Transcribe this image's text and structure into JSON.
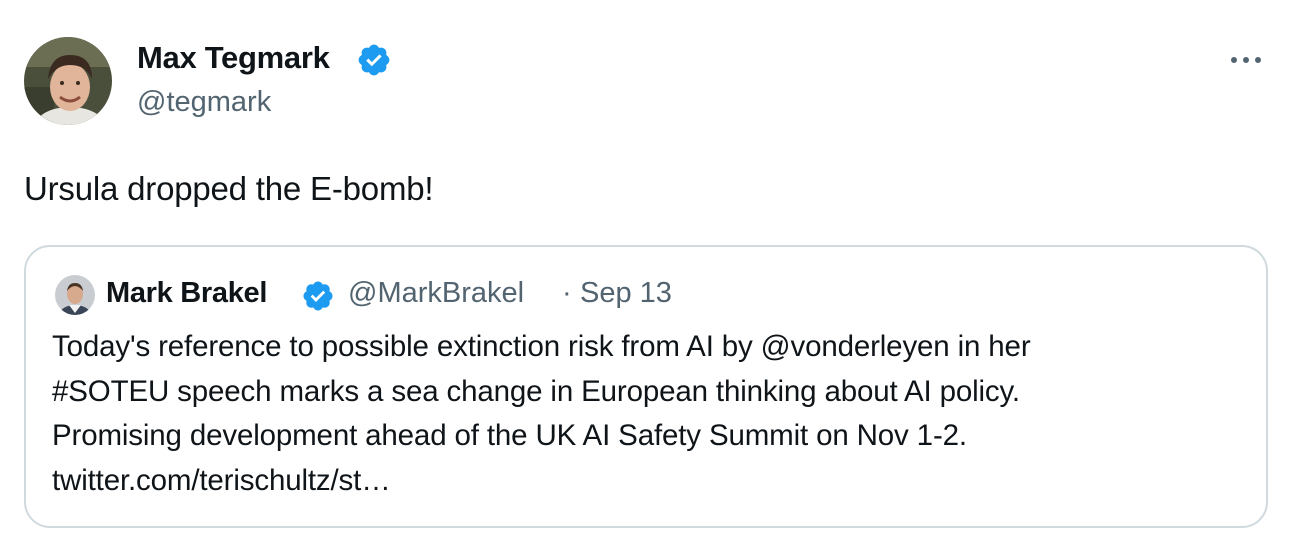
{
  "author": {
    "name": "Max Tegmark",
    "handle": "@tegmark",
    "verified_color": "#1d9bf0"
  },
  "more_icon": "more-horizontal-icon",
  "tweet_text": "Ursula dropped the E-bomb!",
  "quote": {
    "name": "Mark Brakel",
    "handle": "@MarkBrakel",
    "separator": "·",
    "date": "Sep 13",
    "lines": [
      "Today's reference to possible extinction risk from AI by @vonderleyen in her",
      "#SOTEU speech marks a sea change in European thinking about AI policy.",
      "Promising development ahead of the UK AI Safety Summit on Nov 1-2.",
      "twitter.com/terischultz/st…"
    ]
  }
}
